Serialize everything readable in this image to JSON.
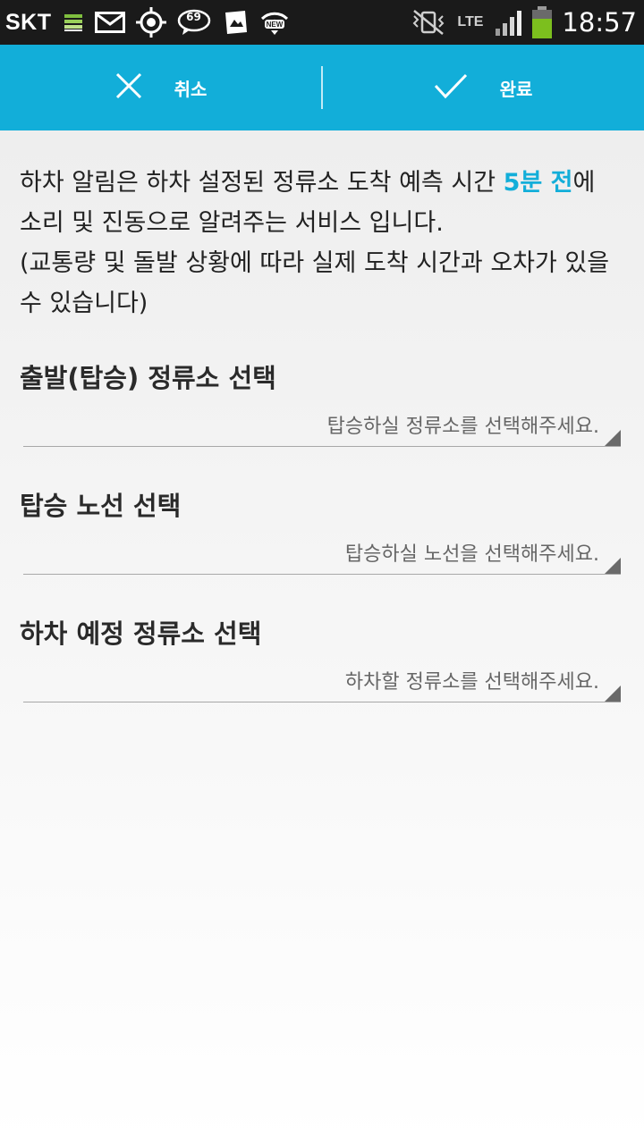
{
  "status_bar": {
    "carrier": "SKT",
    "badge_count": "69",
    "network": "LTE",
    "time": "18:57"
  },
  "action_bar": {
    "cancel_label": "취소",
    "done_label": "완료",
    "accent_color": "#12aed9"
  },
  "intro": {
    "text_before": "하차 알림은 하차 설정된 정류소 도착 예측 시간 ",
    "highlight": "5분 전",
    "text_after": "에 소리 및 진동으로 알려주는 서비스 입니다.",
    "note": "(교통량 및 돌발 상황에 따라 실제 도착 시간과 오차가 있을 수 있습니다)"
  },
  "sections": [
    {
      "title": "출발(탑승) 정류소 선택",
      "placeholder": "탑승하실 정류소를 선택해주세요."
    },
    {
      "title": "탑승 노선 선택",
      "placeholder": "탑승하실 노선을 선택해주세요."
    },
    {
      "title": "하차 예정 정류소 선택",
      "placeholder": "하차할 정류소를 선택해주세요."
    }
  ]
}
